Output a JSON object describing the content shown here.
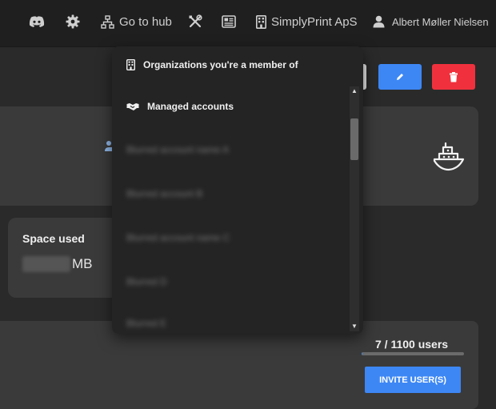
{
  "nav": {
    "hub_label": "Go to hub",
    "org_label": "SimplyPrint ApS",
    "user_label": "Albert Møller Nielsen"
  },
  "dropdown": {
    "organizations_header": "Organizations you're a member of",
    "managed_header": "Managed accounts",
    "accounts": [
      "Blurred account name A",
      "Blurred account B",
      "Blurred account name C",
      "Blurred D",
      "Blurred E"
    ]
  },
  "space": {
    "title": "Space used",
    "unit": "MB"
  },
  "users": {
    "count_label": "7 / 1100 users",
    "used": 7,
    "total": 1100,
    "invite_label": "INVITE USER(S)"
  },
  "colors": {
    "accent_blue": "#3d87f5",
    "danger_red": "#f0313d",
    "nav_bg": "#1f1f1f",
    "page_bg": "#2a2a2a",
    "card_bg": "#3a3a3a"
  }
}
